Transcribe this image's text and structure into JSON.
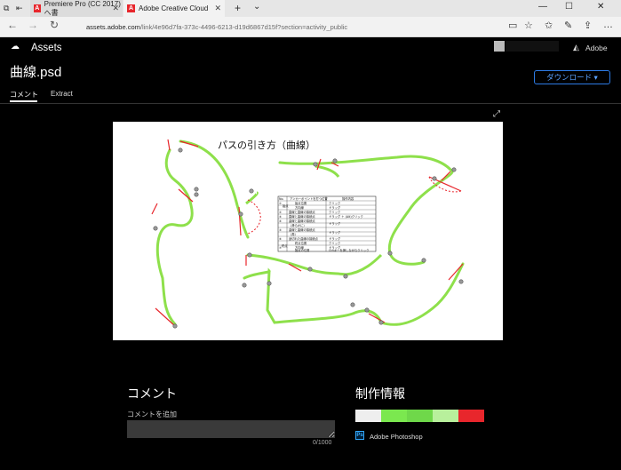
{
  "browser": {
    "tabs": [
      {
        "label": "Premiere Pro (CC 2017) へ書",
        "favicon": "A"
      },
      {
        "label": "Adobe Creative Cloud",
        "favicon": "A"
      }
    ],
    "new_tab": "+",
    "tab_menu": "⌄",
    "window": {
      "minimize": "—",
      "maximize": "☐",
      "close": "✕"
    },
    "nav": {
      "back": "←",
      "forward": "→",
      "refresh": "↻"
    },
    "url_domain": "assets.adobe.com",
    "url_path": "/link/4e96d7fa-373c-4496-6213-d19d6867d15f?section=activity_public",
    "toolbar_icons": [
      "reading-view-icon",
      "favorite-star-icon",
      "hub-icon",
      "notes-icon",
      "share-icon",
      "more-icon"
    ],
    "toolbar_glyphs": [
      "▭",
      "☆",
      "✩",
      "✎",
      "⇪",
      "…"
    ]
  },
  "app": {
    "logo_glyph": "☁",
    "assets_label": "Assets",
    "adobe_glyph": "◭",
    "adobe_label": "Adobe",
    "file_title": "曲線.psd",
    "download_label": "ダウンロード ▾",
    "tabs": {
      "comment": "コメント",
      "extract": "Extract"
    },
    "expand_glyph": "⤢"
  },
  "preview": {
    "title": "パスの引き方（曲線）",
    "table_headers": [
      "No.",
      "アンカーポイントを打つ位置",
      "操作内容"
    ],
    "table_rows": [
      {
        "no": "①",
        "group": "始点",
        "position": "始点位置",
        "action": "クリック"
      },
      {
        "no": "",
        "group": "",
        "position": "方向線",
        "action": "ドラッグ"
      },
      {
        "no": "②",
        "group": "",
        "position": "直線と直線の接続点",
        "action": "クリック"
      },
      {
        "no": "③",
        "group": "",
        "position": "直線と曲線の接続点",
        "action": "ドラッグ ＋ (Alt)クリック"
      },
      {
        "no": "④",
        "group": "",
        "position": "曲線と曲線の接続点",
        "action": ""
      },
      {
        "no": "",
        "group": "",
        "position": "（滑らかに）",
        "action": "ドラッグ"
      },
      {
        "no": "⑤",
        "group": "",
        "position": "曲線と曲線の接続点",
        "action": ""
      },
      {
        "no": "",
        "group": "",
        "position": "（角）",
        "action": "ドラッグ"
      },
      {
        "no": "⑥",
        "group": "",
        "position": "途切れた曲線の接続点",
        "action": "ドラッグ"
      },
      {
        "no": "",
        "group": "終点",
        "position": "終点位置",
        "action": "クリック"
      },
      {
        "no": "⑦",
        "group": "",
        "position": "方向線",
        "action": "ドラッグ"
      },
      {
        "no": "",
        "group": "",
        "position": "始点の位置",
        "action": "Ctrlキーを押しながらクリック"
      }
    ]
  },
  "comments": {
    "heading": "コメント",
    "add_label": "コメントを追加",
    "char_count": "0/1000"
  },
  "info": {
    "heading": "制作情報",
    "swatches": [
      "#eeeeee",
      "#7be84f",
      "#6fd84a",
      "#b8f09c",
      "#e8262c"
    ],
    "app_icon": "Ps",
    "app_name": "Adobe Photoshop"
  }
}
